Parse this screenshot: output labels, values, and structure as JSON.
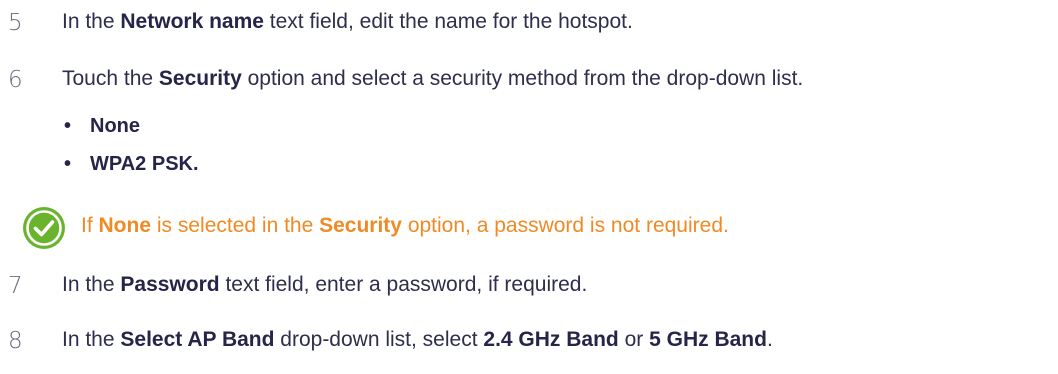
{
  "steps": [
    {
      "number": "5",
      "before": "In the ",
      "bold": "Network name",
      "after": " text field, edit the name for the hotspot."
    },
    {
      "number": "6",
      "before": "Touch the ",
      "bold": "Security",
      "after": " option and select a security method from the drop-down list."
    },
    {
      "number": "7",
      "before": "In the ",
      "bold": "Password",
      "after": " text field, enter a password, if required."
    },
    {
      "number": "8",
      "before": "In the ",
      "bold": "Select AP Band",
      "middle1": " drop-down list, select ",
      "bold2": "2.4 GHz Band",
      "middle2": " or ",
      "bold3": "5 GHz Band",
      "after": "."
    }
  ],
  "security_options": [
    "None",
    "WPA2 PSK."
  ],
  "bullet_glyph": "•",
  "note": {
    "icon": "checkmark-circle-icon",
    "part1": "If ",
    "hl1": "None",
    "part2": " is selected in the ",
    "hl2": "Security",
    "part3": " option, a password is not required.",
    "color": "#f08a24",
    "icon_color": "#6ab42d"
  }
}
